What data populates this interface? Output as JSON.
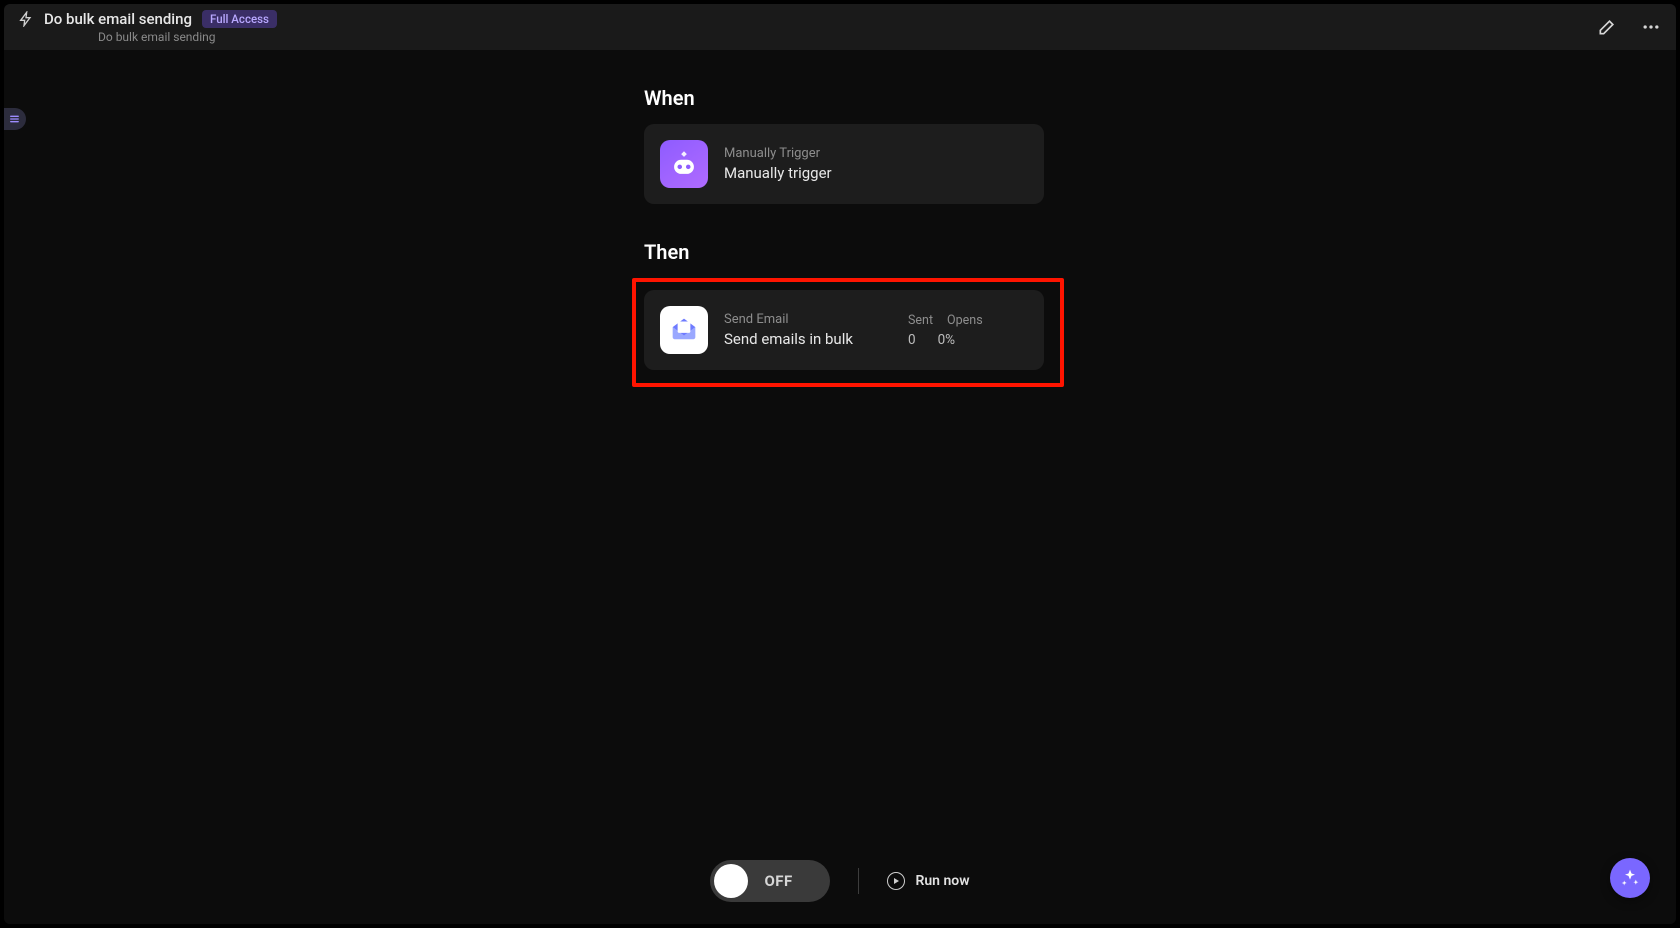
{
  "header": {
    "title": "Do bulk email sending",
    "badge": "Full Access",
    "subtitle": "Do bulk email sending"
  },
  "sections": {
    "when_title": "When",
    "then_title": "Then"
  },
  "trigger_card": {
    "small": "Manually Trigger",
    "big": "Manually trigger"
  },
  "action_card": {
    "small": "Send Email",
    "big": "Send emails in bulk",
    "stat_label_sent": "Sent",
    "stat_label_opens": "Opens",
    "stat_sent": "0",
    "stat_opens": "0%"
  },
  "bottom": {
    "toggle_label": "OFF",
    "run_now": "Run now"
  }
}
